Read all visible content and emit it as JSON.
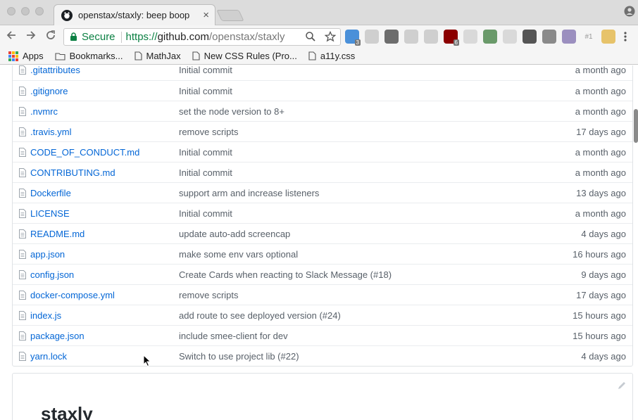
{
  "browser": {
    "tab": {
      "title": "openstax/staxly: beep boop",
      "close_label": "×"
    },
    "address_bar": {
      "secure_label": "Secure",
      "url_scheme": "https://",
      "url_host": "github.com",
      "url_path": "/openstax/staxly"
    },
    "extensions": [
      {
        "icon": "s-extension-icon",
        "badge": "3",
        "color": "#4a90d9"
      },
      {
        "icon": "chat-extension-icon",
        "badge": "",
        "color": "#cfcfcf"
      },
      {
        "icon": "wrench-extension-icon",
        "badge": "",
        "color": "#6d6d6d"
      },
      {
        "icon": "circle-extension-icon",
        "badge": "",
        "color": "#cfcfcf"
      },
      {
        "icon": "reader-extension-icon",
        "badge": "",
        "color": "#cfcfcf"
      },
      {
        "icon": "ublock-icon",
        "badge": "6",
        "color": "#8b0000"
      },
      {
        "icon": "gear-extension-icon",
        "badge": "",
        "color": "#d9d9d9"
      },
      {
        "icon": "green-ball-extension-icon",
        "badge": "",
        "color": "#6a9a6a"
      },
      {
        "icon": "image-extension-icon",
        "badge": "",
        "color": "#d9d9d9"
      },
      {
        "icon": "bars-extension-icon",
        "badge": "",
        "color": "#555555"
      },
      {
        "icon": "w-extension-icon",
        "badge": "",
        "color": "#8a8a8a"
      },
      {
        "icon": "bug-extension-icon",
        "badge": "",
        "color": "#9b8fbf"
      },
      {
        "icon": "hash-extension-icon",
        "badge": "",
        "color": "#cccccc",
        "label": "#1"
      },
      {
        "icon": "face-extension-icon",
        "badge": "",
        "color": "#e7c36a"
      }
    ]
  },
  "bookmarks": [
    {
      "label": "Apps",
      "icon": "apps-grid-icon"
    },
    {
      "label": "Bookmarks...",
      "icon": "folder-icon"
    },
    {
      "label": "MathJax",
      "icon": "page-icon"
    },
    {
      "label": "New CSS Rules (Pro...",
      "icon": "page-icon"
    },
    {
      "label": "a11y.css",
      "icon": "page-icon"
    }
  ],
  "files": [
    {
      "name": ".gitattributes",
      "message": "Initial commit",
      "age": "a month ago"
    },
    {
      "name": ".gitignore",
      "message": "Initial commit",
      "age": "a month ago"
    },
    {
      "name": ".nvmrc",
      "message": "set the node version to 8+",
      "age": "a month ago"
    },
    {
      "name": ".travis.yml",
      "message": "remove scripts",
      "age": "17 days ago"
    },
    {
      "name": "CODE_OF_CONDUCT.md",
      "message": "Initial commit",
      "age": "a month ago"
    },
    {
      "name": "CONTRIBUTING.md",
      "message": "Initial commit",
      "age": "a month ago"
    },
    {
      "name": "Dockerfile",
      "message": "support arm and increase listeners",
      "age": "13 days ago"
    },
    {
      "name": "LICENSE",
      "message": "Initial commit",
      "age": "a month ago"
    },
    {
      "name": "README.md",
      "message": "update auto-add screencap",
      "age": "4 days ago"
    },
    {
      "name": "app.json",
      "message": "make some env vars optional",
      "age": "16 hours ago"
    },
    {
      "name": "config.json",
      "message": "Create Cards when reacting to Slack Message (#18)",
      "age": "9 days ago"
    },
    {
      "name": "docker-compose.yml",
      "message": "remove scripts",
      "age": "17 days ago"
    },
    {
      "name": "index.js",
      "message": "add route to see deployed version (#24)",
      "age": "15 hours ago"
    },
    {
      "name": "package.json",
      "message": "include smee-client for dev",
      "age": "15 hours ago"
    },
    {
      "name": "yarn.lock",
      "message": "Switch to use project lib (#22)",
      "age": "4 days ago"
    }
  ],
  "readme": {
    "title": "staxly"
  },
  "colors": {
    "link": "#0366d6",
    "muted": "#586069",
    "secure": "#0b8043"
  }
}
